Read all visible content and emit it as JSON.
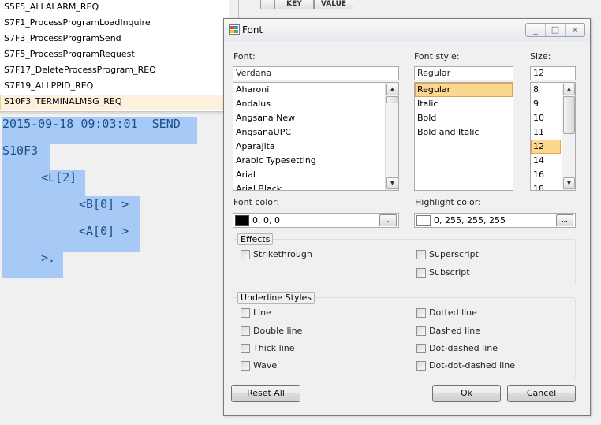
{
  "background": {
    "messages": [
      "S5F5_ALLALARM_REQ",
      "S7F1_ProcessProgramLoadInquire",
      "S7F3_ProcessProgramSend",
      "S7F5_ProcessProgramRequest",
      "S7F17_DeleteProcessProgram_REQ",
      "S7F19_ALLPPID_REQ",
      "S10F3_TERMINALMSG_REQ"
    ],
    "selected_message": "S10F3_TERMINALMSG_REQ",
    "log_lines": [
      "2015-09-18 09:03:01  SEND",
      "S10F3",
      "<L[2]",
      "<B[0] >",
      "<A[0] >",
      ">."
    ],
    "grid_headers": [
      "KEY",
      "VALUE"
    ],
    "highlight_color": "#a6c9f5",
    "text_color": "#1a4f8c"
  },
  "dialog": {
    "title": "Font",
    "window_buttons": [
      "_",
      "□",
      "×"
    ],
    "font_label": "Font:",
    "font_value": "Verdana",
    "fonts": [
      "Aharoni",
      "Andalus",
      "Angsana New",
      "AngsanaUPC",
      "Aparajita",
      "Arabic Typesetting",
      "Arial",
      "Arial Black"
    ],
    "style_label": "Font style:",
    "style_value": "Regular",
    "styles": [
      "Regular",
      "Italic",
      "Bold",
      "Bold and Italic"
    ],
    "selected_style": "Regular",
    "size_label": "Size:",
    "size_value": "12",
    "sizes": [
      "8",
      "9",
      "10",
      "11",
      "12",
      "14",
      "16",
      "18"
    ],
    "selected_size": "12",
    "font_color_label": "Font color:",
    "font_color_value": "0, 0, 0",
    "font_color_hex": "#000000",
    "highlight_label": "Highlight color:",
    "highlight_value": "0, 255, 255, 255",
    "highlight_hex": "#ffffff",
    "dots": "...",
    "effects_title": "Effects",
    "effects": {
      "strikethrough": "Strikethrough",
      "superscript": "Superscript",
      "subscript": "Subscript"
    },
    "underline_title": "Underline Styles",
    "underline": {
      "line": "Line",
      "double_line": "Double line",
      "thick_line": "Thick line",
      "wave": "Wave",
      "dotted_line": "Dotted line",
      "dashed_line": "Dashed line",
      "dot_dashed_line": "Dot-dashed line",
      "dot_dot_dashed_line": "Dot-dot-dashed line"
    },
    "reset_label": "Reset All",
    "ok_label": "Ok",
    "cancel_label": "Cancel",
    "list_selection_color": "#fcd78d"
  }
}
